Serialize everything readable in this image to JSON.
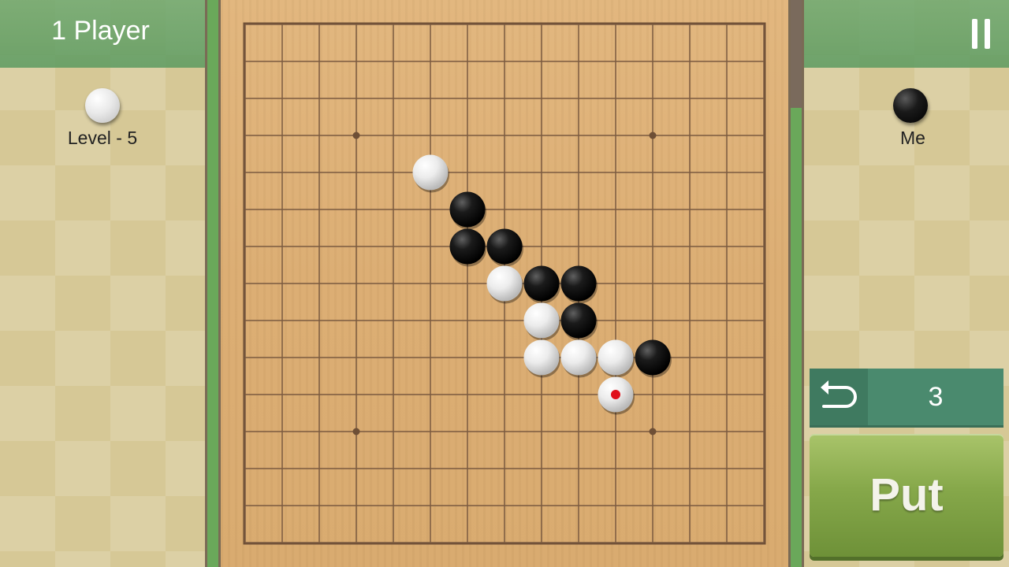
{
  "header": {
    "title": "1 Player",
    "pause_icon": "pause-icon"
  },
  "players": {
    "opponent": {
      "label": "Level - 5",
      "stone": "white"
    },
    "me": {
      "label": "Me",
      "stone": "black"
    }
  },
  "controls": {
    "undo_icon": "undo-icon",
    "undo_count": "3",
    "put_label": "Put"
  },
  "timer": {
    "fraction_remaining": 0.81
  },
  "board": {
    "size": 15,
    "star_points": [
      [
        3,
        3
      ],
      [
        11,
        3
      ],
      [
        3,
        11
      ],
      [
        11,
        11
      ]
    ],
    "stones": [
      {
        "c": "white",
        "x": 5,
        "y": 4
      },
      {
        "c": "black",
        "x": 6,
        "y": 5
      },
      {
        "c": "black",
        "x": 6,
        "y": 6
      },
      {
        "c": "black",
        "x": 7,
        "y": 6
      },
      {
        "c": "white",
        "x": 7,
        "y": 7
      },
      {
        "c": "black",
        "x": 8,
        "y": 7
      },
      {
        "c": "black",
        "x": 9,
        "y": 7
      },
      {
        "c": "white",
        "x": 8,
        "y": 8
      },
      {
        "c": "black",
        "x": 9,
        "y": 8
      },
      {
        "c": "white",
        "x": 8,
        "y": 9
      },
      {
        "c": "white",
        "x": 9,
        "y": 9
      },
      {
        "c": "white",
        "x": 10,
        "y": 9
      },
      {
        "c": "black",
        "x": 11,
        "y": 9
      },
      {
        "c": "white",
        "x": 10,
        "y": 10,
        "last": true
      }
    ]
  },
  "colors": {
    "accent": "#5b9a60",
    "last_move_marker": "#e0101a"
  }
}
